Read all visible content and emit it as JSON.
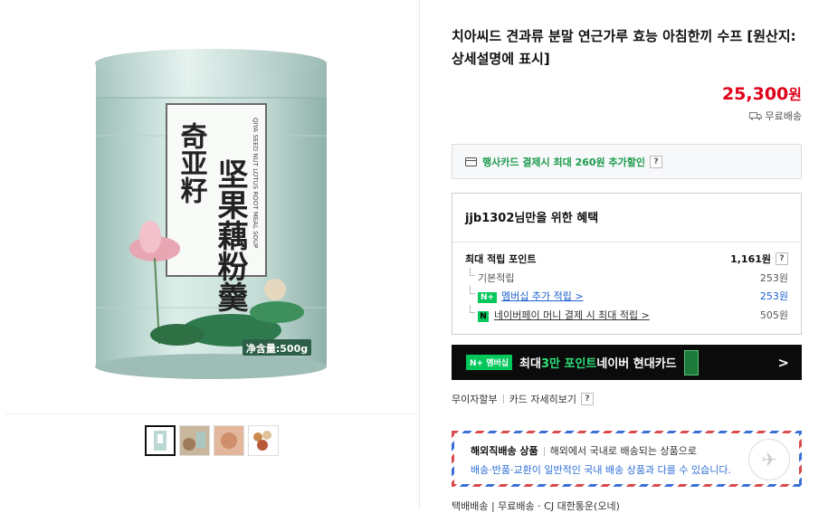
{
  "product": {
    "title": "치아씨드 견과류 분말 연근가루 효능 아침한끼 수프 [원산지:상세설명에 표시]",
    "price": "25,300",
    "price_unit": "원",
    "shipping": "무료배송"
  },
  "image": {
    "label_chinese_side": "奇亚籽",
    "label_chinese_main": "坚果藕粉羹",
    "label_english": "QIYA SEED NUT LOTUS ROOT MEAL SOUP",
    "net_weight": "净含量:500g"
  },
  "card_promo": {
    "text": "행사카드 결제시 최대 260원 추가할인",
    "help": "?"
  },
  "benefits": {
    "title": "jjb1302님만을 위한 혜택",
    "max_points_label": "최대 적립 포인트",
    "max_points_value": "1,161원",
    "help": "?",
    "basic_label": "기본적립",
    "basic_value": "253원",
    "membership_badge": "N+",
    "membership_label": "멤버십 추가 적립 >",
    "membership_value": "253원",
    "pay_badge": "N",
    "pay_label": "네이버페이 머니 결제 시 최대 적립 >",
    "pay_value": "505원"
  },
  "banner": {
    "badge": "N+ 멤버십",
    "text_before": "최대 ",
    "highlight": "3만 포인트",
    "text_after": " 네이버 현대카드",
    "chevron": ">"
  },
  "installment": {
    "no_interest": "무이자할부",
    "card_detail": "카드 자세히보기",
    "help": "?"
  },
  "overseas": {
    "label": "해외직배송 상품",
    "desc": "해외에서 국내로 배송되는 상품으로",
    "note": "배송·반품·교환이 일반적인 국내 배송 상품과 다를 수 있습니다."
  },
  "delivery": {
    "text": "택배배송  |  무료배송  ·  CJ 대한통운(오네)"
  },
  "colors": {
    "price": "#e0001a",
    "naver_green": "#03c75a",
    "link_blue": "#1a5fd0"
  }
}
